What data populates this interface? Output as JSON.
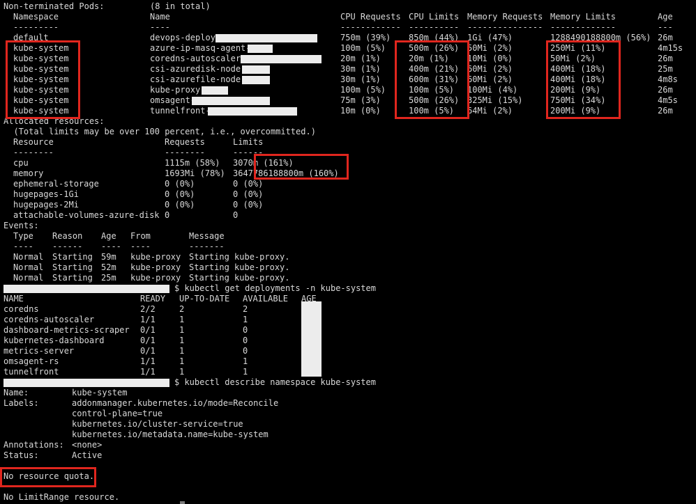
{
  "pods": {
    "title": "Non-terminated Pods:",
    "count": "(8 in total)",
    "headers": [
      "Namespace",
      "Name",
      "CPU Requests",
      "CPU Limits",
      "Memory Requests",
      "Memory Limits",
      "Age"
    ],
    "dashes": [
      "---------",
      "----",
      "------------",
      "----------",
      "---------------",
      "-------------",
      "---"
    ],
    "rows": [
      [
        "default",
        "devops-deploym",
        "750m (39%)",
        "850m (44%)",
        "1Gi (47%)",
        "1288490188800m (56%)",
        "26m"
      ],
      [
        "kube-system",
        "azure-ip-masq-agent-",
        "100m (5%)",
        "500m (26%)",
        "50Mi (2%)",
        "250Mi (11%)",
        "4m15s"
      ],
      [
        "kube-system",
        "coredns-autoscaler-",
        "20m (1%)",
        "20m (1%)",
        "10Mi (0%)",
        "50Mi (2%)",
        "26m"
      ],
      [
        "kube-system",
        "csi-azuredisk-node-",
        "30m (1%)",
        "400m (21%)",
        "60Mi (2%)",
        "400Mi (18%)",
        "25m"
      ],
      [
        "kube-system",
        "csi-azurefile-node-",
        "30m (1%)",
        "600m (31%)",
        "60Mi (2%)",
        "400Mi (18%)",
        "4m8s"
      ],
      [
        "kube-system",
        "kube-proxy-",
        "100m (5%)",
        "100m (5%)",
        "100Mi (4%)",
        "200Mi (9%)",
        "26m"
      ],
      [
        "kube-system",
        "omsagent-7",
        "75m (3%)",
        "500m (26%)",
        "325Mi (15%)",
        "750Mi (34%)",
        "4m5s"
      ],
      [
        "kube-system",
        "tunnelfront-",
        "10m (0%)",
        "100m (5%)",
        "64Mi (2%)",
        "200Mi (9%)",
        "26m"
      ]
    ]
  },
  "allocated": {
    "title": "Allocated resources:",
    "note": "  (Total limits may be over 100 percent, i.e., overcommitted.)",
    "headers": [
      "Resource",
      "Requests",
      "Limits"
    ],
    "dashes": [
      "--------",
      "--------",
      "------"
    ],
    "rows": [
      [
        "cpu",
        "1115m (58%)",
        "3070m (161%)"
      ],
      [
        "memory",
        "1693Mi (78%)",
        "3647786188800m (160%)"
      ],
      [
        "ephemeral-storage",
        "0 (0%)",
        "0 (0%)"
      ],
      [
        "hugepages-1Gi",
        "0 (0%)",
        "0 (0%)"
      ],
      [
        "hugepages-2Mi",
        "0 (0%)",
        "0 (0%)"
      ],
      [
        "attachable-volumes-azure-disk",
        "0",
        "0"
      ]
    ]
  },
  "events": {
    "title": "Events:",
    "headers": [
      "Type",
      "Reason",
      "Age",
      "From",
      "Message"
    ],
    "dashes": [
      "----",
      "------",
      "----",
      "----",
      "-------"
    ],
    "rows": [
      [
        "Normal",
        "Starting",
        "59m",
        "kube-proxy",
        "Starting kube-proxy."
      ],
      [
        "Normal",
        "Starting",
        "52m",
        "kube-proxy",
        "Starting kube-proxy."
      ],
      [
        "Normal",
        "Starting",
        "25m",
        "kube-proxy",
        "Starting kube-proxy."
      ]
    ]
  },
  "prompt1": {
    "cmd": "$ kubectl get deployments -n kube-system"
  },
  "deployments": {
    "headers": [
      "NAME",
      "READY",
      "UP-TO-DATE",
      "AVAILABLE",
      "AGE"
    ],
    "rows": [
      [
        "coredns",
        "2/2",
        "2",
        "2"
      ],
      [
        "coredns-autoscaler",
        "1/1",
        "1",
        "1"
      ],
      [
        "dashboard-metrics-scraper",
        "0/1",
        "1",
        "0"
      ],
      [
        "kubernetes-dashboard",
        "0/1",
        "1",
        "0"
      ],
      [
        "metrics-server",
        "0/1",
        "1",
        "0"
      ],
      [
        "omsagent-rs",
        "1/1",
        "1",
        "1"
      ],
      [
        "tunnelfront",
        "1/1",
        "1",
        "1"
      ]
    ]
  },
  "prompt2": {
    "cmd": "$ kubectl describe namespace kube-system"
  },
  "namespace": {
    "name_label": "Name:",
    "name_value": "kube-system",
    "labels_label": "Labels:",
    "labels": [
      "addonmanager.kubernetes.io/mode=Reconcile",
      "control-plane=true",
      "kubernetes.io/cluster-service=true",
      "kubernetes.io/metadata.name=kube-system"
    ],
    "annotations_label": "Annotations:",
    "annotations_value": "<none>",
    "status_label": "Status:",
    "status_value": "Active",
    "quota": "No resource quota.",
    "limitrange": "No LimitRange resource."
  },
  "colors": {
    "background": "#000000",
    "text": "#d9d9d9",
    "highlight": "#e0261e",
    "redaction": "#ececec"
  }
}
